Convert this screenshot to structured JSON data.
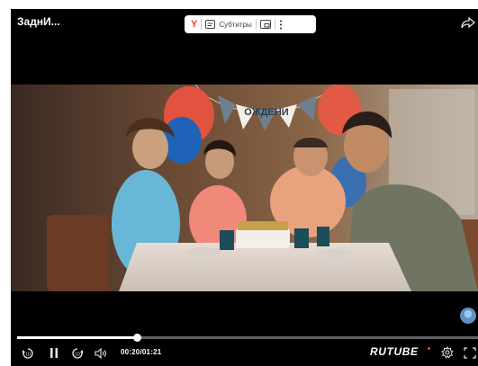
{
  "player": {
    "title": "ЗаднИ...",
    "current_time": "00:20",
    "duration": "01:21",
    "time_separator": "/",
    "progress": 0.26,
    "logo": "RUTUBE"
  },
  "extension_bar": {
    "subtitles_label": "Субтитры"
  },
  "banner": {
    "text": "ОЖДЕНИ"
  },
  "icons": {
    "share": "share-icon",
    "yandex": "yandex-icon",
    "subtitles": "subtitles-icon",
    "pip": "picture-in-picture-icon",
    "menu": "more-vertical-icon",
    "rewind": "rewind-10-icon",
    "pause": "pause-icon",
    "forward": "forward-10-icon",
    "volume": "volume-icon",
    "settings": "gear-icon",
    "fullscreen": "fullscreen-icon"
  },
  "colors": {
    "player_bg": "#000000",
    "accent": "#ffffff",
    "yandex": "#fc3f1d",
    "logo_dot": "#ff3a5e"
  }
}
